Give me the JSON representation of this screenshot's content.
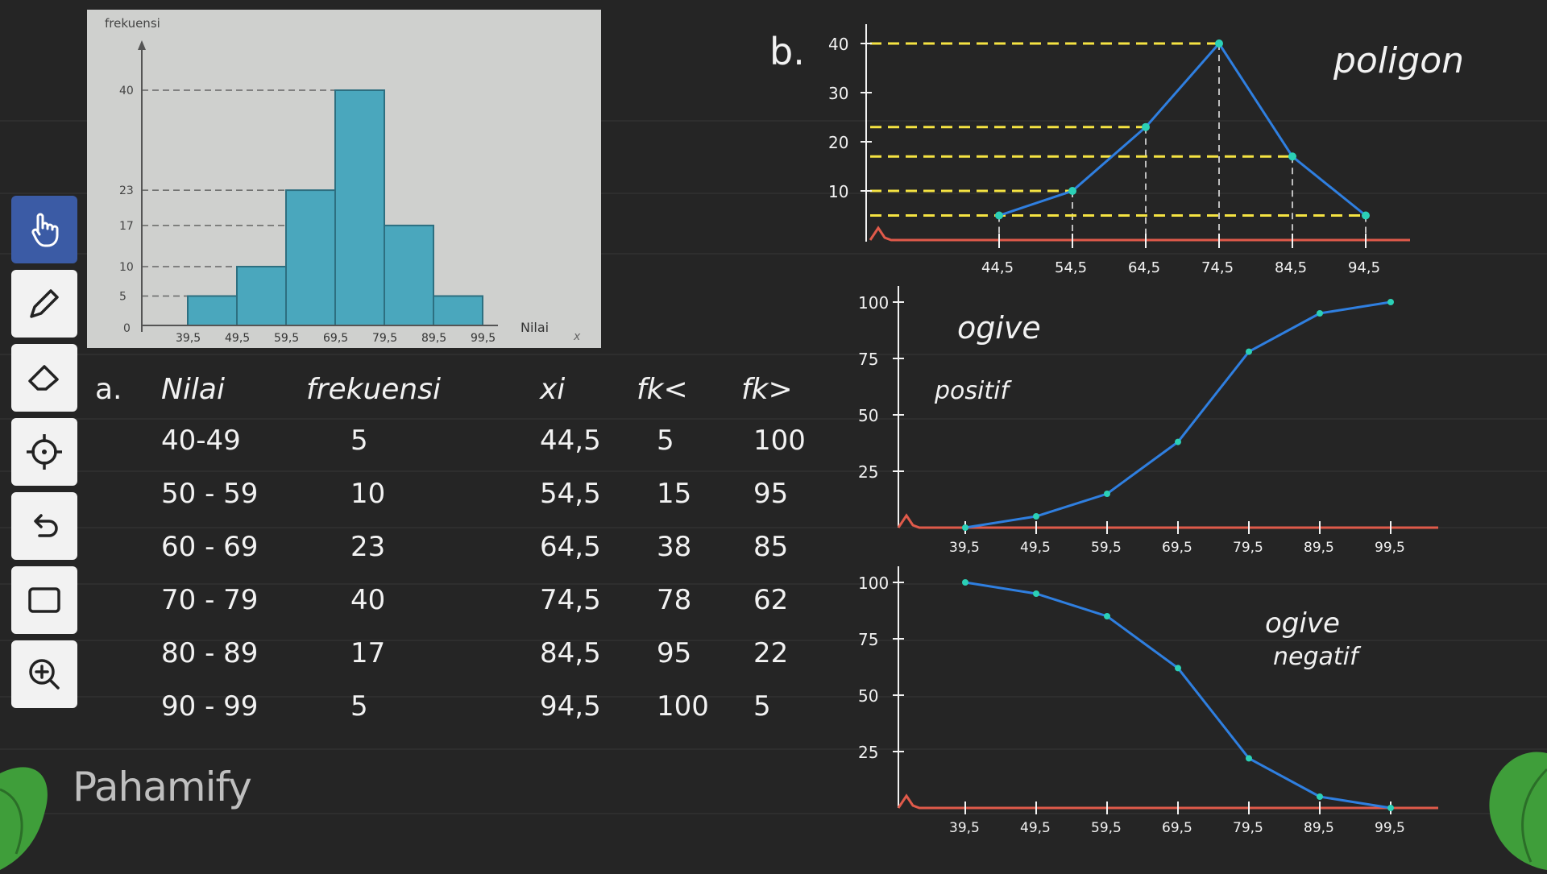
{
  "toolbar": {
    "tools": [
      {
        "name": "hand-tool",
        "icon": "hand-icon"
      },
      {
        "name": "pen-tool",
        "icon": "pen-icon"
      },
      {
        "name": "eraser-tool",
        "icon": "eraser-icon"
      },
      {
        "name": "laser-tool",
        "icon": "crosshair-icon"
      },
      {
        "name": "undo-tool",
        "icon": "undo-icon"
      },
      {
        "name": "shape-tool",
        "icon": "rectangle-icon"
      },
      {
        "name": "zoom-tool",
        "icon": "zoom-in-icon"
      }
    ],
    "active_color": "#3b5ba5"
  },
  "histogram_photo": {
    "ylabel": "frekuensi",
    "xlabel": "Nilai",
    "x_symbol": "x",
    "origin": "0",
    "yticks": [
      "40",
      "23",
      "17",
      "10",
      "5"
    ],
    "xticks": [
      "39,5",
      "49,5",
      "59,5",
      "69,5",
      "79,5",
      "89,5",
      "99,5"
    ],
    "bar_color": "#4aa7bd"
  },
  "table": {
    "part_label": "a.",
    "headers": [
      "Nilai",
      "frekuensi",
      "xi",
      "fk<",
      "fk>"
    ],
    "rows": [
      [
        "40-49",
        "5",
        "44,5",
        "5",
        "100"
      ],
      [
        "50 - 59",
        "10",
        "54,5",
        "15",
        "95"
      ],
      [
        "60 - 69",
        "23",
        "64,5",
        "38",
        "85"
      ],
      [
        "70 - 79",
        "40",
        "74,5",
        "78",
        "62"
      ],
      [
        "80 - 89",
        "17",
        "84,5",
        "95",
        "22"
      ],
      [
        "90 - 99",
        "5",
        "94,5",
        "100",
        "5"
      ]
    ]
  },
  "polygon": {
    "part_label": "b.",
    "title": "poligon",
    "yticks": [
      "40",
      "30",
      "20",
      "10"
    ],
    "xticks": [
      "44,5",
      "54,5",
      "64,5",
      "74,5",
      "84,5",
      "94,5"
    ]
  },
  "ogive_pos": {
    "title_line1": "ogive",
    "title_line2": "positif",
    "yticks": [
      "100",
      "75",
      "50",
      "25"
    ],
    "xticks": [
      "39,5",
      "49,5",
      "59,5",
      "69,5",
      "79,5",
      "89,5",
      "99,5"
    ]
  },
  "ogive_neg": {
    "title_line1": "ogive",
    "title_line2": "negatif",
    "yticks": [
      "100",
      "75",
      "50",
      "25"
    ],
    "xticks": [
      "39,5",
      "49,5",
      "59,5",
      "69,5",
      "79,5",
      "89,5",
      "99,5"
    ]
  },
  "brand": {
    "logo_text": "Pahamify"
  },
  "colors": {
    "handwriting": "#f2f2f2",
    "guides": "#f5e342",
    "graph_line": "#2f7fe0",
    "axis": "#e05a4a"
  },
  "chart_data": [
    {
      "type": "bar",
      "ylabel": "frekuensi",
      "xlabel": "Nilai",
      "x_edges": [
        39.5,
        49.5,
        59.5,
        69.5,
        79.5,
        89.5,
        99.5
      ],
      "values": [
        5,
        10,
        23,
        40,
        17,
        5
      ],
      "yticks": [
        5,
        10,
        17,
        23,
        40
      ]
    },
    {
      "type": "line",
      "title": "poligon",
      "x": [
        44.5,
        54.5,
        64.5,
        74.5,
        84.5,
        94.5
      ],
      "y": [
        5,
        10,
        23,
        40,
        17,
        5
      ],
      "ylim": [
        0,
        40
      ]
    },
    {
      "type": "line",
      "title": "ogive positif",
      "x": [
        39.5,
        49.5,
        59.5,
        69.5,
        79.5,
        89.5,
        99.5
      ],
      "y": [
        0,
        5,
        15,
        38,
        78,
        95,
        100
      ],
      "ylim": [
        0,
        100
      ]
    },
    {
      "type": "line",
      "title": "ogive negatif",
      "x": [
        39.5,
        49.5,
        59.5,
        69.5,
        79.5,
        89.5,
        99.5
      ],
      "y": [
        100,
        95,
        85,
        62,
        22,
        5,
        0
      ],
      "ylim": [
        0,
        100
      ]
    }
  ]
}
